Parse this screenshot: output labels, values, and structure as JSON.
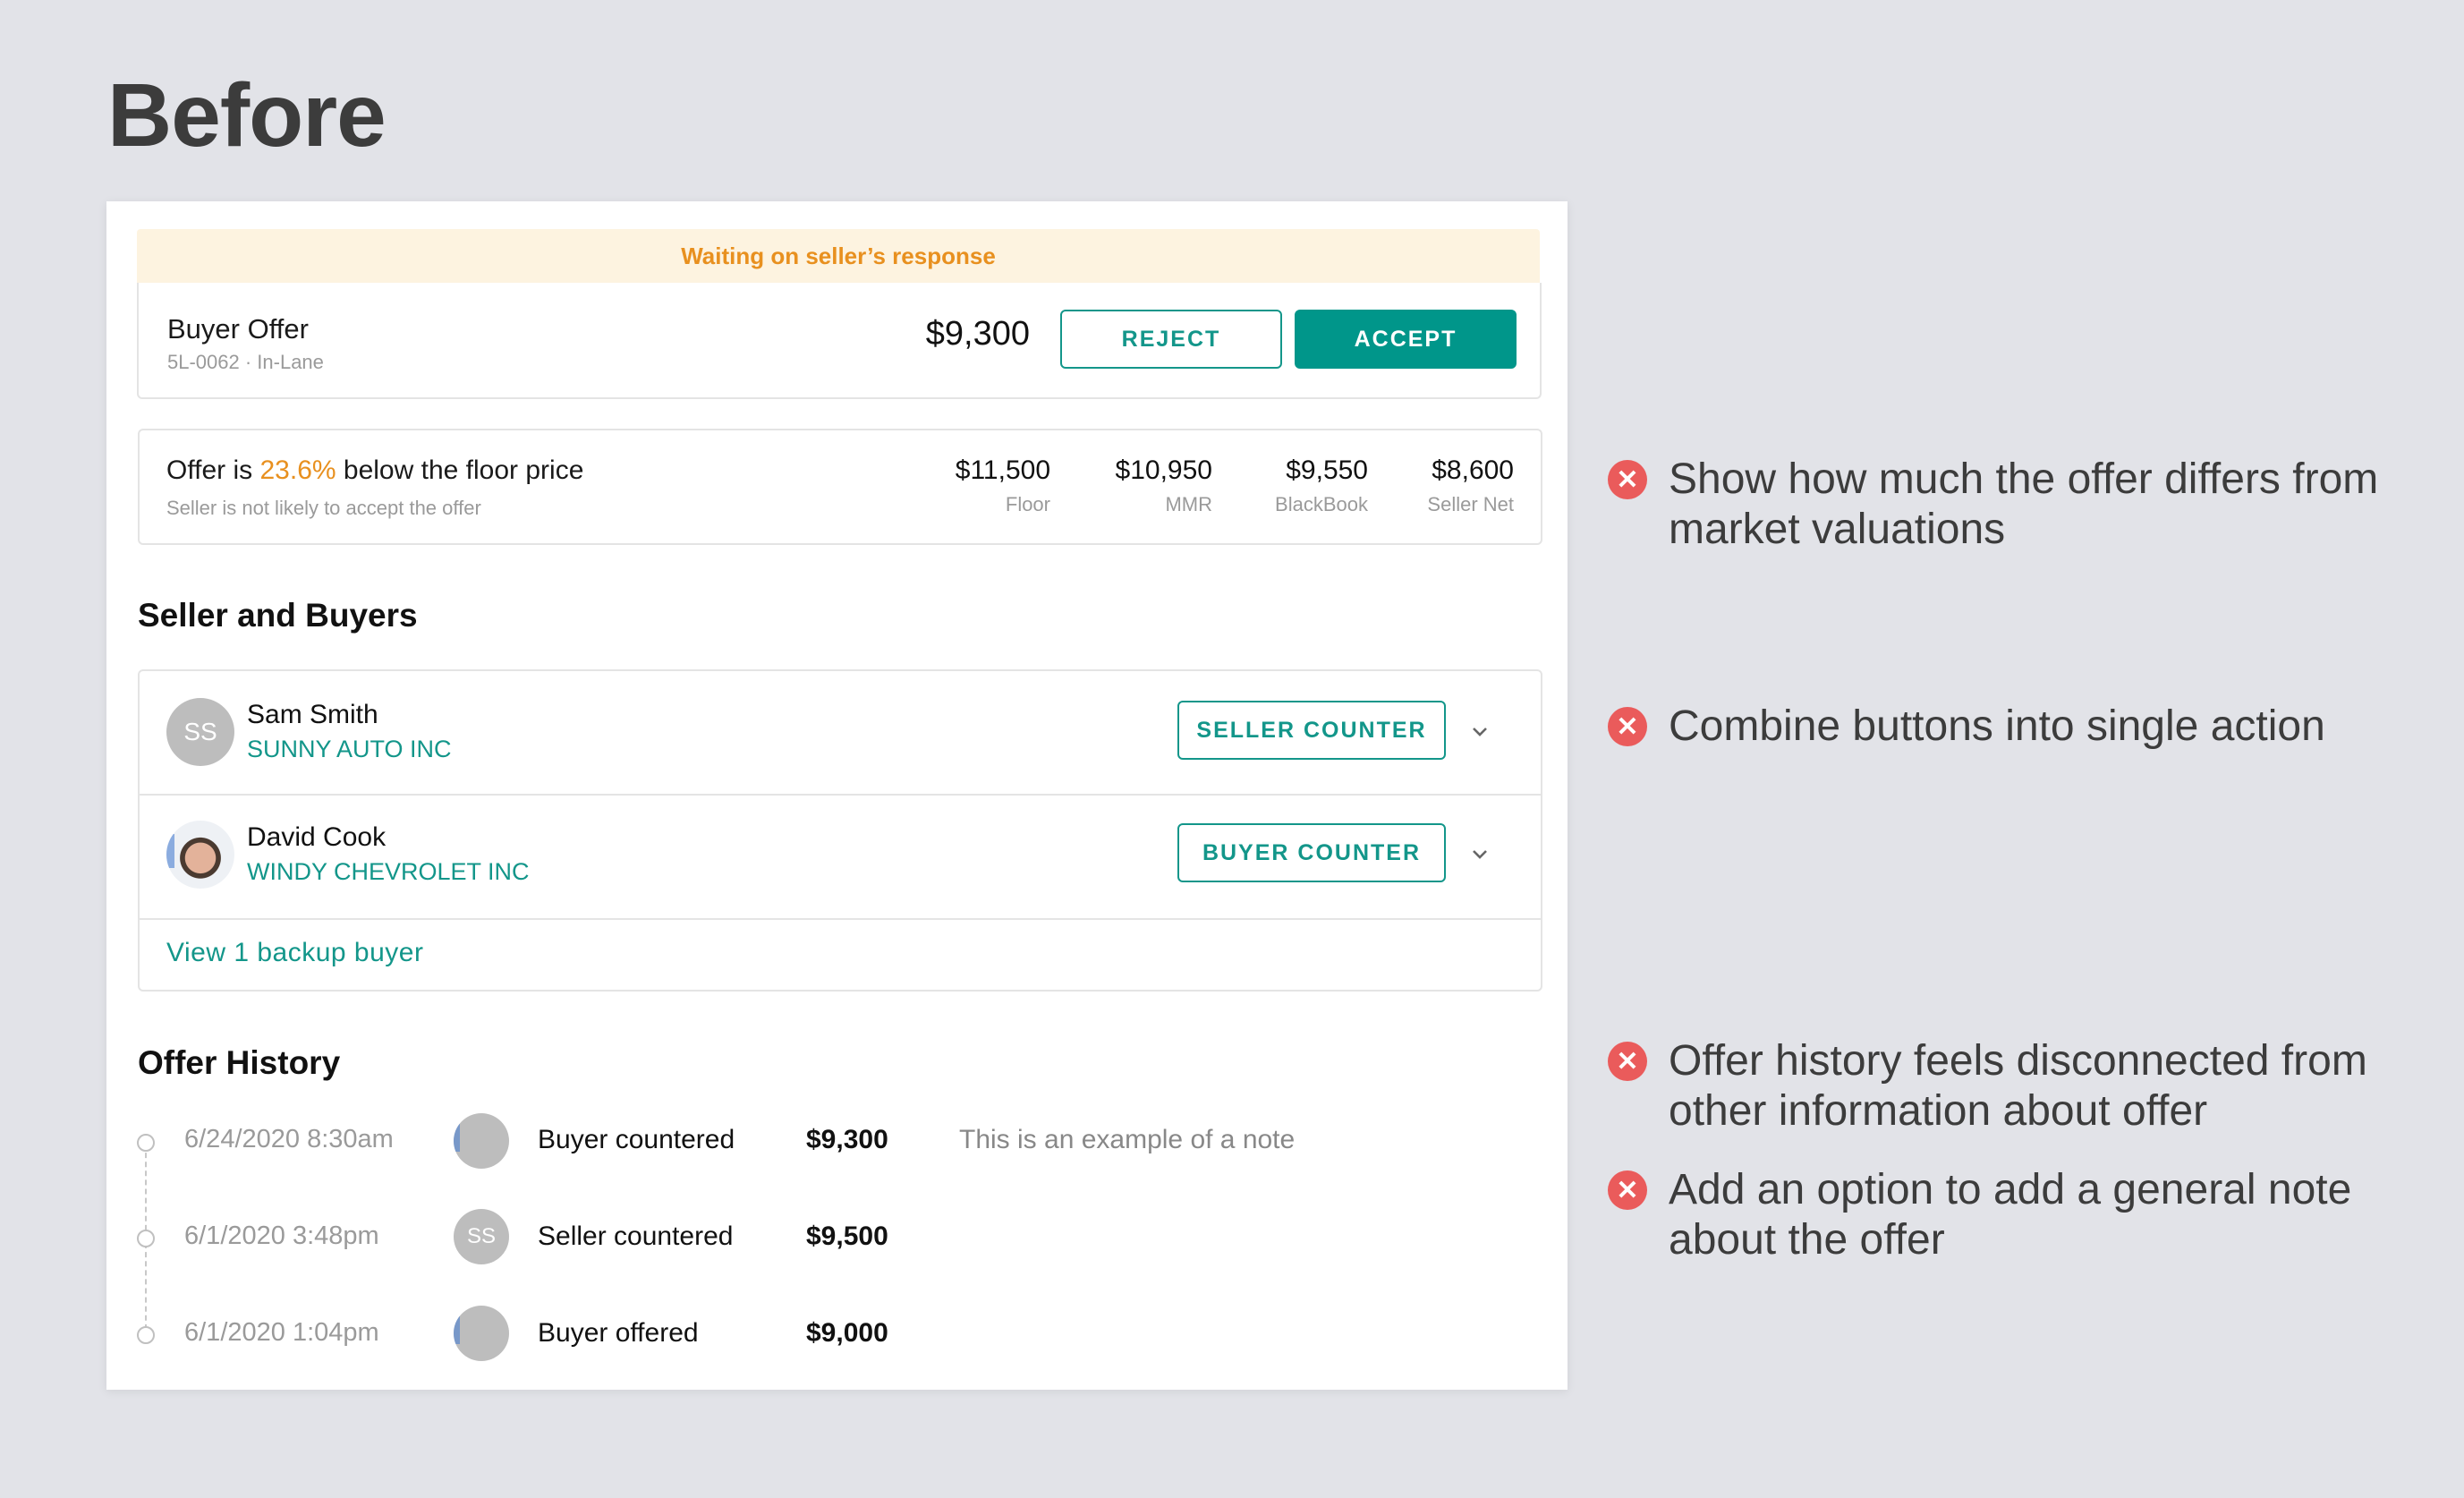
{
  "page_title": "Before",
  "status_banner": "Waiting on seller’s response",
  "offer": {
    "title": "Buyer Offer",
    "subtitle": "5L-0062 · In-Lane",
    "price": "$9,300",
    "reject_label": "REJECT",
    "accept_label": "ACCEPT"
  },
  "market": {
    "headline_prefix": "Offer is ",
    "headline_pct": "23.6%",
    "headline_suffix": " below the floor price",
    "subtext": "Seller is not likely to accept the offer",
    "valuations": [
      {
        "amount": "$11,500",
        "label": "Floor"
      },
      {
        "amount": "$10,950",
        "label": "MMR"
      },
      {
        "amount": "$9,550",
        "label": "BlackBook"
      },
      {
        "amount": "$8,600",
        "label": "Seller Net"
      }
    ]
  },
  "parties": {
    "heading": "Seller and Buyers",
    "rows": [
      {
        "initials": "SS",
        "name": "Sam Smith",
        "company": "SUNNY AUTO INC",
        "button": "SELLER COUNTER"
      },
      {
        "initials": "",
        "name": "David Cook",
        "company": "WINDY CHEVROLET INC",
        "button": "BUYER COUNTER"
      }
    ],
    "backup_link": "View 1 backup buyer"
  },
  "history": {
    "heading": "Offer History",
    "rows": [
      {
        "date": "6/24/2020 8:30am",
        "avatar": "photo",
        "action": "Buyer countered",
        "amount": "$9,300",
        "note": "This is an example of a note"
      },
      {
        "date": "6/1/2020 3:48pm",
        "avatar": "SS",
        "action": "Seller countered",
        "amount": "$9,500",
        "note": ""
      },
      {
        "date": "6/1/2020 1:04pm",
        "avatar": "photo",
        "action": "Buyer offered",
        "amount": "$9,000",
        "note": ""
      }
    ]
  },
  "annotations": [
    {
      "icon": "x-circle-icon",
      "text": "Show how much the offer differs from market valuations"
    },
    {
      "icon": "x-circle-icon",
      "text": "Combine buttons into single action"
    },
    {
      "icon": "x-circle-icon",
      "text": "Offer history feels disconnected from other information about offer"
    },
    {
      "icon": "x-circle-icon",
      "text": "Add an option to add a general note about the offer"
    }
  ],
  "colors": {
    "accent": "#00968a",
    "warning": "#e8901f",
    "banner_bg": "#fdf3e0",
    "annotation_icon": "#ea5b5b"
  }
}
